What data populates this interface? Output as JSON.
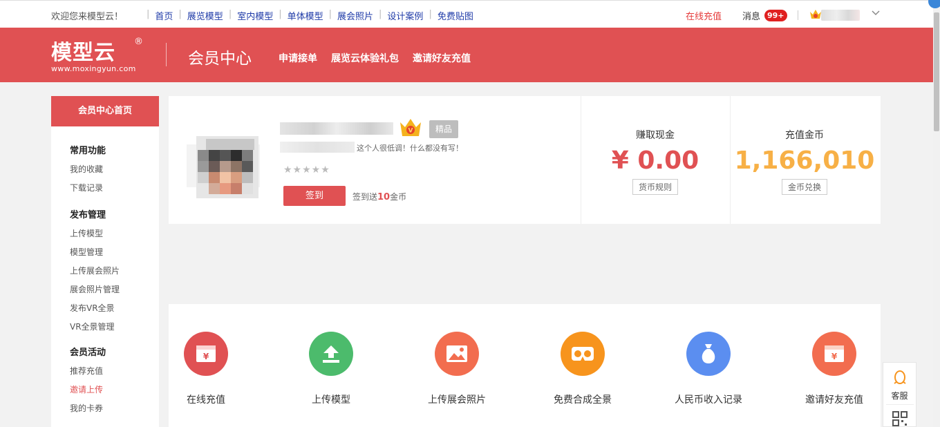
{
  "topbar": {
    "welcome": "欢迎您来模型云！",
    "nav": [
      "首页",
      "展览模型",
      "室内模型",
      "单体模型",
      "展会照片",
      "设计案例",
      "免费贴图"
    ],
    "recharge": "在线充值",
    "messages_label": "消息",
    "messages_badge": "99+"
  },
  "header": {
    "logo_name": "模型云",
    "logo_reg": "®",
    "logo_url": "www.moxingyun.com",
    "title": "会员中心",
    "nav": [
      "申请接单",
      "展览云体验礼包",
      "邀请好友充值"
    ]
  },
  "sidebar": {
    "home": "会员中心首页",
    "groups": [
      {
        "title": "常用功能",
        "items": [
          "我的收藏",
          "下载记录"
        ]
      },
      {
        "title": "发布管理",
        "items": [
          "上传模型",
          "模型管理",
          "上传展会照片",
          "展会照片管理",
          "发布VR全景",
          "VR全景管理"
        ]
      },
      {
        "title": "会员活动",
        "items": [
          "推荐充值",
          "邀请上传",
          "我的卡券"
        ]
      }
    ]
  },
  "profile": {
    "badge": "精品",
    "motto": "这个人很低调！什么都没有写！",
    "stars": "★★★★★",
    "signin_button": "签到",
    "signin_tip_prefix": "签到送",
    "signin_tip_amount": "10",
    "signin_tip_suffix": "金币",
    "earned_label": "赚取现金",
    "earned_value": "¥ 0.00",
    "earned_link": "货币规则",
    "coins_label": "充值金币",
    "coins_value": "1,166,010",
    "coins_link": "金币兑换"
  },
  "actions": [
    {
      "label": "在线充值",
      "color": "#e05153",
      "icon": "yen-card-icon"
    },
    {
      "label": "上传模型",
      "color": "#4cbb6c",
      "icon": "upload-icon"
    },
    {
      "label": "上传展会照片",
      "color": "#f26d4f",
      "icon": "image-icon"
    },
    {
      "label": "免费合成全景",
      "color": "#f7941d",
      "icon": "vr-glasses-icon"
    },
    {
      "label": "人民币收入记录",
      "color": "#5b8ef0",
      "icon": "money-bag-icon"
    },
    {
      "label": "邀请好友充值",
      "color": "#f26d4f",
      "icon": "yen-card-icon"
    }
  ],
  "float": {
    "service": "客服"
  },
  "colors": {
    "brand": "#e05153",
    "cash": "#e05153",
    "coins": "#f7b046"
  }
}
